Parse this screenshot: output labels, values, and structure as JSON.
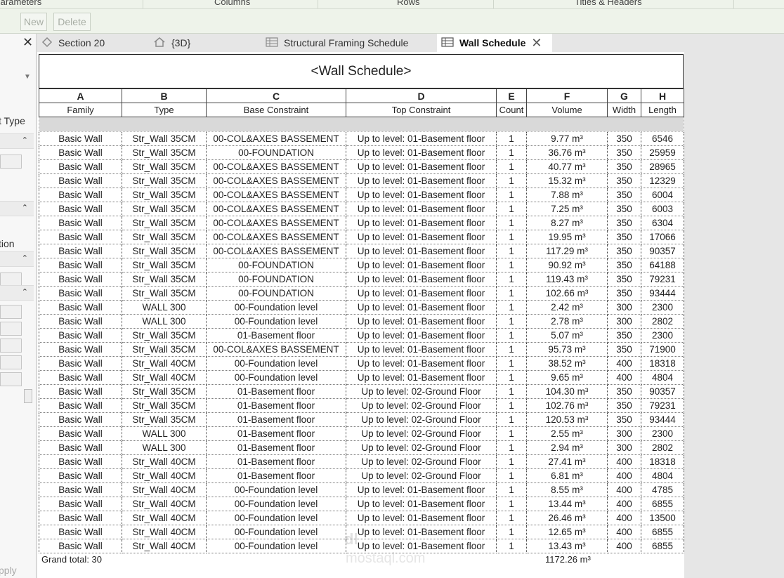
{
  "ribbon": {
    "tabs": [
      "Parameters",
      "Columns",
      "Rows",
      "Titles & Headers"
    ],
    "buttons": {
      "new": "New",
      "delete": "Delete"
    }
  },
  "left_panel": {
    "type_label": "t Type",
    "section_label": "tion",
    "apply_label": "pply"
  },
  "view_tabs": [
    {
      "label": "Section 20",
      "icon": "section-icon"
    },
    {
      "label": "{3D}",
      "icon": "house-icon"
    },
    {
      "label": "Structural Framing Schedule",
      "icon": "schedule-icon"
    },
    {
      "label": "Wall Schedule",
      "icon": "schedule-icon",
      "active": true
    }
  ],
  "schedule": {
    "title": "<Wall Schedule>",
    "letters": [
      "A",
      "B",
      "C",
      "D",
      "E",
      "F",
      "G",
      "H"
    ],
    "headers": [
      "Family",
      "Type",
      "Base Constraint",
      "Top Constraint",
      "Count",
      "Volume",
      "Width",
      "Length"
    ],
    "rows": [
      [
        "Basic Wall",
        "Str_Wall 35CM",
        "00-COL&AXES BASSEMENT",
        "Up to level: 01-Basement floor",
        "1",
        "9.77 m³",
        "350",
        "6546"
      ],
      [
        "Basic Wall",
        "Str_Wall 35CM",
        "00-FOUNDATION",
        "Up to level: 01-Basement floor",
        "1",
        "36.76 m³",
        "350",
        "25959"
      ],
      [
        "Basic Wall",
        "Str_Wall 35CM",
        "00-COL&AXES BASSEMENT",
        "Up to level: 01-Basement floor",
        "1",
        "40.77 m³",
        "350",
        "28965"
      ],
      [
        "Basic Wall",
        "Str_Wall 35CM",
        "00-COL&AXES BASSEMENT",
        "Up to level: 01-Basement floor",
        "1",
        "15.32 m³",
        "350",
        "12329"
      ],
      [
        "Basic Wall",
        "Str_Wall 35CM",
        "00-COL&AXES BASSEMENT",
        "Up to level: 01-Basement floor",
        "1",
        "7.88 m³",
        "350",
        "6004"
      ],
      [
        "Basic Wall",
        "Str_Wall 35CM",
        "00-COL&AXES BASSEMENT",
        "Up to level: 01-Basement floor",
        "1",
        "7.25 m³",
        "350",
        "6003"
      ],
      [
        "Basic Wall",
        "Str_Wall 35CM",
        "00-COL&AXES BASSEMENT",
        "Up to level: 01-Basement floor",
        "1",
        "8.27 m³",
        "350",
        "6304"
      ],
      [
        "Basic Wall",
        "Str_Wall 35CM",
        "00-COL&AXES BASSEMENT",
        "Up to level: 01-Basement floor",
        "1",
        "19.95 m³",
        "350",
        "17066"
      ],
      [
        "Basic Wall",
        "Str_Wall 35CM",
        "00-COL&AXES BASSEMENT",
        "Up to level: 01-Basement floor",
        "1",
        "117.29 m³",
        "350",
        "90357"
      ],
      [
        "Basic Wall",
        "Str_Wall 35CM",
        "00-FOUNDATION",
        "Up to level: 01-Basement floor",
        "1",
        "90.92 m³",
        "350",
        "64188"
      ],
      [
        "Basic Wall",
        "Str_Wall 35CM",
        "00-FOUNDATION",
        "Up to level: 01-Basement floor",
        "1",
        "119.43 m³",
        "350",
        "79231"
      ],
      [
        "Basic Wall",
        "Str_Wall 35CM",
        "00-FOUNDATION",
        "Up to level: 01-Basement floor",
        "1",
        "102.66 m³",
        "350",
        "93444"
      ],
      [
        "Basic Wall",
        "WALL 300",
        "00-Foundation level",
        "Up to level: 01-Basement floor",
        "1",
        "2.42 m³",
        "300",
        "2300"
      ],
      [
        "Basic Wall",
        "WALL 300",
        "00-Foundation level",
        "Up to level: 01-Basement floor",
        "1",
        "2.78 m³",
        "300",
        "2802"
      ],
      [
        "Basic Wall",
        "Str_Wall 35CM",
        "01-Basement floor",
        "Up to level: 01-Basement floor",
        "1",
        "5.07 m³",
        "350",
        "2300"
      ],
      [
        "Basic Wall",
        "Str_Wall 35CM",
        "00-COL&AXES BASSEMENT",
        "Up to level: 01-Basement floor",
        "1",
        "95.73 m³",
        "350",
        "71900"
      ],
      [
        "Basic Wall",
        "Str_Wall 40CM",
        "00-Foundation level",
        "Up to level: 01-Basement floor",
        "1",
        "38.52 m³",
        "400",
        "18318"
      ],
      [
        "Basic Wall",
        "Str_Wall 40CM",
        "00-Foundation level",
        "Up to level: 01-Basement floor",
        "1",
        "9.65 m³",
        "400",
        "4804"
      ],
      [
        "Basic Wall",
        "Str_Wall 35CM",
        "01-Basement floor",
        "Up to level: 02-Ground Floor",
        "1",
        "104.30 m³",
        "350",
        "90357"
      ],
      [
        "Basic Wall",
        "Str_Wall 35CM",
        "01-Basement floor",
        "Up to level: 02-Ground Floor",
        "1",
        "102.76 m³",
        "350",
        "79231"
      ],
      [
        "Basic Wall",
        "Str_Wall 35CM",
        "01-Basement floor",
        "Up to level: 02-Ground Floor",
        "1",
        "120.53 m³",
        "350",
        "93444"
      ],
      [
        "Basic Wall",
        "WALL 300",
        "01-Basement floor",
        "Up to level: 02-Ground Floor",
        "1",
        "2.55 m³",
        "300",
        "2300"
      ],
      [
        "Basic Wall",
        "WALL 300",
        "01-Basement floor",
        "Up to level: 02-Ground Floor",
        "1",
        "2.94 m³",
        "300",
        "2802"
      ],
      [
        "Basic Wall",
        "Str_Wall 40CM",
        "01-Basement floor",
        "Up to level: 02-Ground Floor",
        "1",
        "27.41 m³",
        "400",
        "18318"
      ],
      [
        "Basic Wall",
        "Str_Wall 40CM",
        "01-Basement floor",
        "Up to level: 02-Ground Floor",
        "1",
        "6.81 m³",
        "400",
        "4804"
      ],
      [
        "Basic Wall",
        "Str_Wall 40CM",
        "00-Foundation level",
        "Up to level: 01-Basement floor",
        "1",
        "8.55 m³",
        "400",
        "4785"
      ],
      [
        "Basic Wall",
        "Str_Wall 40CM",
        "00-Foundation level",
        "Up to level: 01-Basement floor",
        "1",
        "13.44 m³",
        "400",
        "6855"
      ],
      [
        "Basic Wall",
        "Str_Wall 40CM",
        "00-Foundation level",
        "Up to level: 01-Basement floor",
        "1",
        "26.46 m³",
        "400",
        "13500"
      ],
      [
        "Basic Wall",
        "Str_Wall 40CM",
        "00-Foundation level",
        "Up to level: 01-Basement floor",
        "1",
        "12.65 m³",
        "400",
        "6855"
      ],
      [
        "Basic Wall",
        "Str_Wall 40CM",
        "00-Foundation level",
        "Up to level: 01-Basement floor",
        "1",
        "13.43 m³",
        "400",
        "6855"
      ]
    ],
    "grand_total_label": "Grand total: 30",
    "grand_total_volume": "1172.26 m³"
  },
  "watermark": {
    "line1": "dl",
    "line2": "mostaql.com"
  }
}
